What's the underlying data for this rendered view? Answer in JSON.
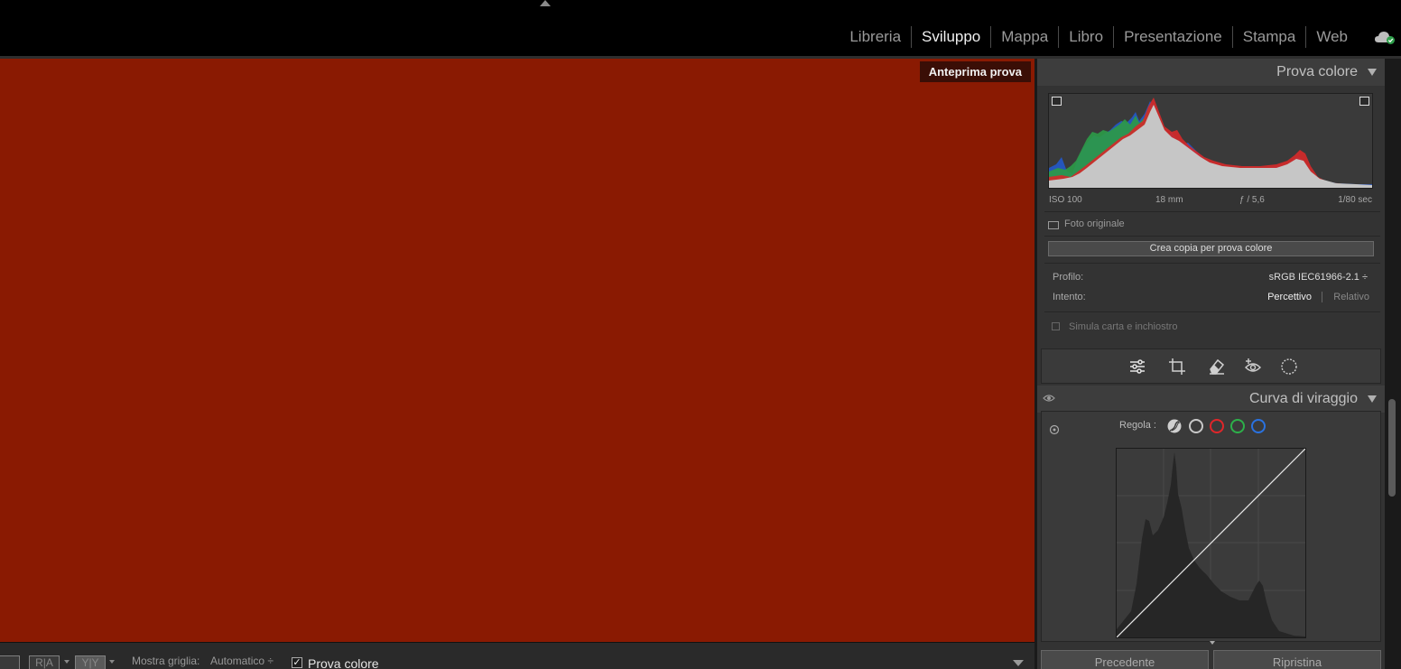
{
  "modules": [
    "Libreria",
    "Sviluppo",
    "Mappa",
    "Libro",
    "Presentazione",
    "Stampa",
    "Web"
  ],
  "active_module": "Sviluppo",
  "preview": {
    "badge": "Anteprima prova",
    "background_color": "#8a1a02"
  },
  "toolbar": {
    "view_ra": "R|A",
    "view_yy": "Y|Y",
    "grid_label": "Mostra griglia:",
    "grid_value": "Automatico ÷",
    "soft_proof_checked": "✓",
    "soft_proof_label": "Prova colore"
  },
  "soft_proof_panel": {
    "title": "Prova colore",
    "histogram_info": {
      "iso": "ISO 100",
      "focal": "18 mm",
      "aperture": "ƒ / 5,6",
      "shutter": "1/80 sec"
    },
    "original_photo_label": "Foto originale",
    "create_copy_button": "Crea copia per prova colore",
    "profile_label": "Profilo:",
    "profile_value": "sRGB IEC61966-2.1 ÷",
    "intent_label": "Intento:",
    "intent_perceptual": "Percettivo",
    "intent_relative": "Relativo",
    "simulate_label": "Simula carta e inchiostro"
  },
  "tools": [
    "sliders-icon",
    "crop-icon",
    "eraser-icon",
    "red-eye-icon",
    "mask-icon"
  ],
  "tone_curve_panel": {
    "title": "Curva di viraggio",
    "adjust_label": "Regola :",
    "channel_colors": {
      "white": "#c8c8c8",
      "red": "#e0262a",
      "green": "#2db04a",
      "blue": "#2a72e0"
    }
  },
  "buttons": {
    "previous": "Precedente",
    "reset": "Ripristina"
  }
}
